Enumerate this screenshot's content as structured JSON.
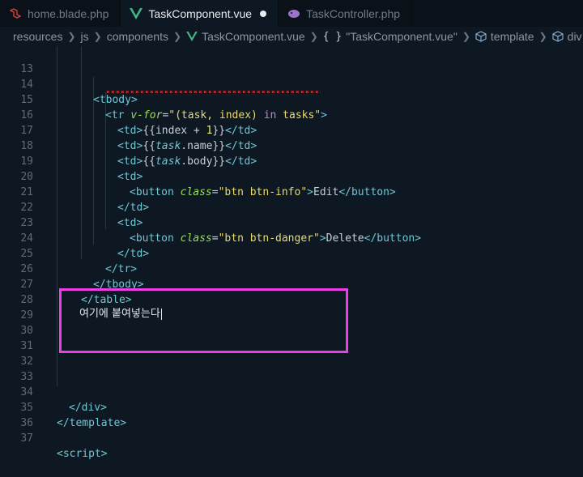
{
  "tabs": [
    {
      "label": "home.blade.php",
      "icon": "laravel-icon",
      "active": false
    },
    {
      "label": "TaskComponent.vue",
      "icon": "vue-icon",
      "active": true,
      "modified": true
    },
    {
      "label": "TaskController.php",
      "icon": "php-elephant-icon",
      "active": false
    }
  ],
  "breadcrumb": {
    "items": [
      "resources",
      "js",
      "components",
      "TaskComponent.vue",
      "\"TaskComponent.vue\"",
      "template",
      "div"
    ]
  },
  "editor": {
    "lines": [
      {
        "n": "13"
      },
      {
        "n": "14"
      },
      {
        "n": "15"
      },
      {
        "n": "16"
      },
      {
        "n": "17"
      },
      {
        "n": "18"
      },
      {
        "n": "19"
      },
      {
        "n": "20"
      },
      {
        "n": "21"
      },
      {
        "n": "22"
      },
      {
        "n": "23"
      },
      {
        "n": "24"
      },
      {
        "n": "25"
      },
      {
        "n": "26"
      },
      {
        "n": "27"
      },
      {
        "n": "28"
      },
      {
        "n": "29"
      },
      {
        "n": "30"
      },
      {
        "n": "31"
      },
      {
        "n": "32"
      },
      {
        "n": "33"
      },
      {
        "n": "34"
      },
      {
        "n": "35"
      },
      {
        "n": "36"
      },
      {
        "n": "37"
      }
    ],
    "tokens": {
      "tbody_open": "<tbody>",
      "tr_open_a": "<tr ",
      "tr_attr": "v-for",
      "tr_eq": "=",
      "tr_q1": "\"(task, index) ",
      "tr_in": "in",
      "tr_q2": " tasks\"",
      "tr_close": ">",
      "td": "<td>",
      "td_end": "</td>",
      "mustache_open": "{{",
      "mustache_close": "}}",
      "index": "index + ",
      "one": "1",
      "task": "task",
      "dot_name": ".name",
      "dot_body": ".body",
      "button_open": "<button ",
      "class_attr": "class",
      "btn_info": "\"btn btn-info\"",
      "btn_danger": "\"btn btn-danger\"",
      "gt": ">",
      "edit": "Edit",
      "delete": "Delete",
      "button_close": "</button>",
      "tr_end": "</tr>",
      "tbody_end": "</tbody>",
      "table_end": "</table>",
      "div_end": "</div>",
      "template_end": "</template>",
      "script_open": "<script>"
    },
    "pasted_note": "여기에 붙여넣는다",
    "highlight_color": "#ee3ee6"
  }
}
